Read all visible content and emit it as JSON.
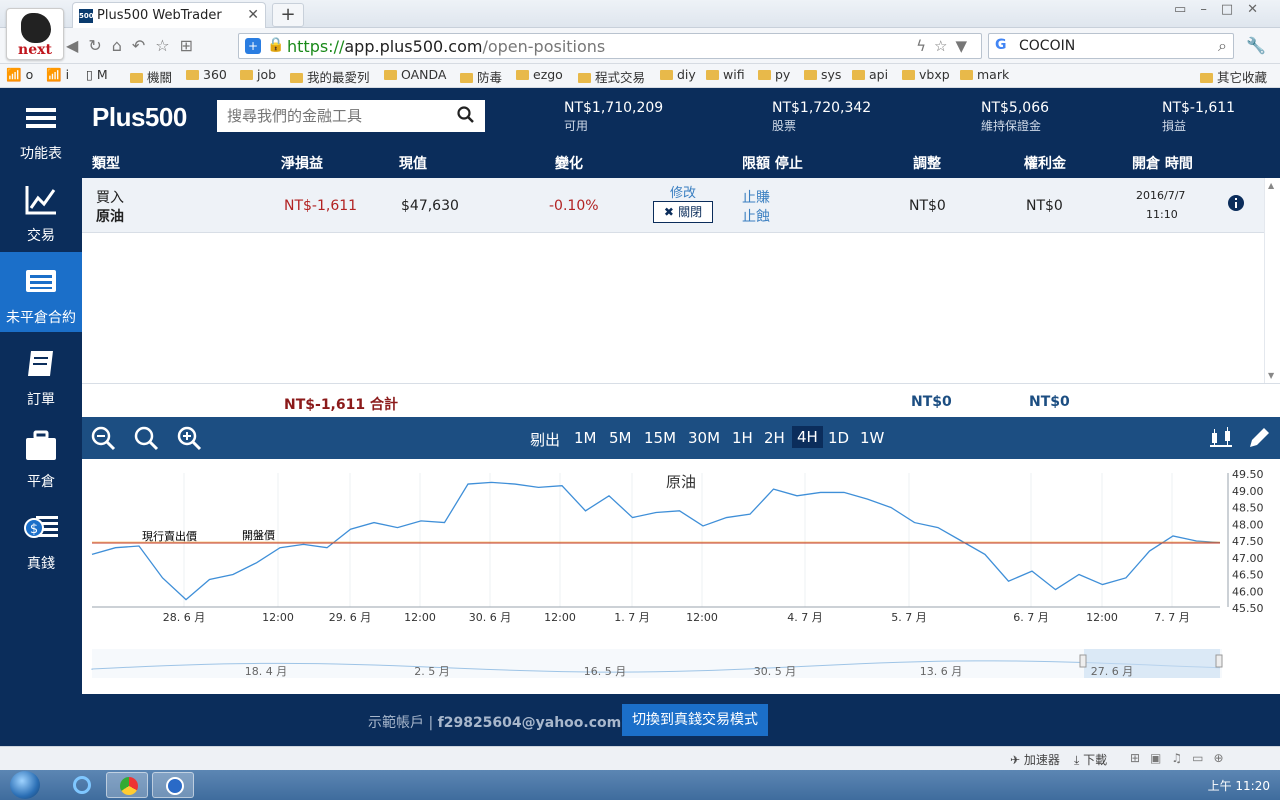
{
  "browser": {
    "brand": "next",
    "tab_title": "Plus500 WebTrader",
    "tab_favicon": "500",
    "url_scheme": "https://",
    "url_host": "app.plus500.com",
    "url_path": "/open-positions",
    "search_value": "COCOIN",
    "search_engine": "G",
    "bookmarks": [
      "o",
      "i",
      "M",
      "機關",
      "360",
      "job",
      "我的最愛列",
      "OANDA",
      "防毒",
      "ezgo",
      "程式交易",
      "diy",
      "wifi",
      "py",
      "sys",
      "api",
      "vbxp",
      "mark"
    ],
    "other_bookmarks": "其它收藏"
  },
  "sidebar": {
    "items": [
      {
        "label": "功能表",
        "icon": "menu-icon"
      },
      {
        "label": "交易",
        "icon": "chart-line-icon"
      },
      {
        "label": "未平倉合約",
        "icon": "positions-icon",
        "active": true
      },
      {
        "label": "訂單",
        "icon": "orders-book-icon"
      },
      {
        "label": "平倉",
        "icon": "briefcase-icon"
      },
      {
        "label": "真錢",
        "icon": "real-money-icon"
      }
    ]
  },
  "header": {
    "logo": "Plus500",
    "search_placeholder": "搜尋我們的金融工具",
    "stats": [
      {
        "value": "NT$1,710,209",
        "label": "可用"
      },
      {
        "value": "NT$1,720,342",
        "label": "股票"
      },
      {
        "value": "NT$5,066",
        "label": "維持保證金"
      },
      {
        "value": "NT$-1,611",
        "label": "損益"
      }
    ]
  },
  "table": {
    "columns": [
      "類型",
      "淨損益",
      "現值",
      "變化",
      "限額 停止",
      "調整",
      "權利金",
      "開倉 時間"
    ],
    "rows": [
      {
        "side": "買入",
        "instrument": "原油",
        "pnl": "NT$-1,611",
        "value": "$47,630",
        "change": "-0.10%",
        "edit": "修改",
        "close": "關閉",
        "take_profit": "止賺",
        "stop_loss": "止蝕",
        "adjustment": "NT$0",
        "premium": "NT$0",
        "open_date": "2016/7/7",
        "open_time": "11:10"
      }
    ],
    "totals": {
      "pnl": "NT$-1,611",
      "label": "合計",
      "adjustment": "NT$0",
      "premium": "NT$0"
    }
  },
  "chart_tools": {
    "timeframes": [
      "剔出",
      "1M",
      "5M",
      "15M",
      "30M",
      "1H",
      "2H",
      "4H",
      "1D",
      "1W"
    ],
    "selected": "4H"
  },
  "chart_data": {
    "type": "line",
    "title": "原油",
    "annotations": [
      "現行賣出價",
      "開盤價"
    ],
    "x_tick_labels": [
      "28. 6 月",
      "12:00",
      "29. 6 月",
      "12:00",
      "30. 6 月",
      "12:00",
      "1. 7 月",
      "12:00",
      "4. 7 月",
      "5. 7 月",
      "6. 7 月",
      "12:00",
      "7. 7 月"
    ],
    "y_tick_labels": [
      "49.50",
      "49.00",
      "48.50",
      "48.00",
      "47.50",
      "47.00",
      "46.50",
      "46.00",
      "45.50"
    ],
    "ylim": [
      45.5,
      49.5
    ],
    "reference_line": 47.44,
    "series": [
      {
        "values": [
          47.1,
          47.3,
          47.35,
          46.4,
          45.75,
          46.35,
          46.5,
          46.85,
          47.3,
          47.4,
          47.3,
          47.85,
          48.05,
          47.9,
          48.1,
          48.05,
          49.2,
          49.25,
          49.2,
          49.1,
          49.15,
          48.4,
          48.85,
          48.2,
          48.35,
          48.4,
          47.95,
          48.2,
          48.3,
          49.05,
          48.85,
          48.95,
          48.95,
          48.75,
          48.5,
          48.05,
          47.9,
          47.5,
          47.1,
          46.3,
          46.6,
          46.05,
          46.5,
          46.2,
          46.4,
          47.2,
          47.65,
          47.5,
          47.45
        ]
      }
    ],
    "navigator_labels": [
      "18. 4 月",
      "2. 5 月",
      "16. 5 月",
      "30. 5 月",
      "13. 6 月",
      "27. 6 月"
    ]
  },
  "footer": {
    "demo_label": "示範帳戶 |",
    "email": "f29825604@yahoo.com.tw",
    "real_button": "切換到真錢交易模式"
  },
  "statusbar": {
    "accelerator": "加速器",
    "download": "下載"
  },
  "taskbar": {
    "time": "上午 11:20"
  }
}
